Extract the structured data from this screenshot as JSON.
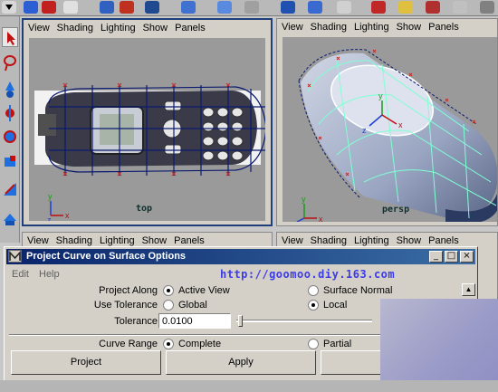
{
  "viewports": {
    "top": {
      "menu": [
        "View",
        "Shading",
        "Lighting",
        "Show",
        "Panels"
      ],
      "camera": "top"
    },
    "persp": {
      "menu": [
        "View",
        "Shading",
        "Lighting",
        "Show",
        "Panels"
      ],
      "camera": "persp"
    },
    "bottom_left": {
      "menu": [
        "View",
        "Shading",
        "Lighting",
        "Show",
        "Panels"
      ]
    },
    "bottom_right": {
      "menu": [
        "View",
        "Shading",
        "Lighting",
        "Show",
        "Panels"
      ]
    }
  },
  "dialog": {
    "title": "Project Curve on Surface Options",
    "title_buttons": {
      "minimize": "_",
      "maximize": "□",
      "close": "×"
    },
    "menu": {
      "edit": "Edit",
      "help": "Help"
    },
    "watermark": "http://goomoo.diy.163.com",
    "project_along": {
      "label": "Project Along",
      "opt1": "Active View",
      "opt2": "Surface Normal",
      "selected": "Active View"
    },
    "use_tolerance": {
      "label": "Use Tolerance",
      "opt1": "Global",
      "opt2": "Local",
      "selected": "Local"
    },
    "tolerance": {
      "label": "Tolerance",
      "value": "0.0100"
    },
    "curve_range": {
      "label": "Curve Range",
      "opt1": "Complete",
      "opt2": "Partial",
      "selected": "Complete"
    },
    "buttons": {
      "project": "Project",
      "apply": "Apply"
    }
  },
  "colors": {
    "titlebar": "#0a246a",
    "active_viewport_border": "#1f3f7a",
    "watermark": "#3b3be8",
    "wireframe": "#0a1a6e",
    "persp_wire": "#7fffd4"
  },
  "icons": {
    "toolbox": [
      "select-arrow-icon",
      "lasso-icon",
      "paint-icon",
      "move-icon",
      "rotate-icon",
      "scale-icon",
      "manipulator-icon",
      "last-tool-icon"
    ]
  }
}
